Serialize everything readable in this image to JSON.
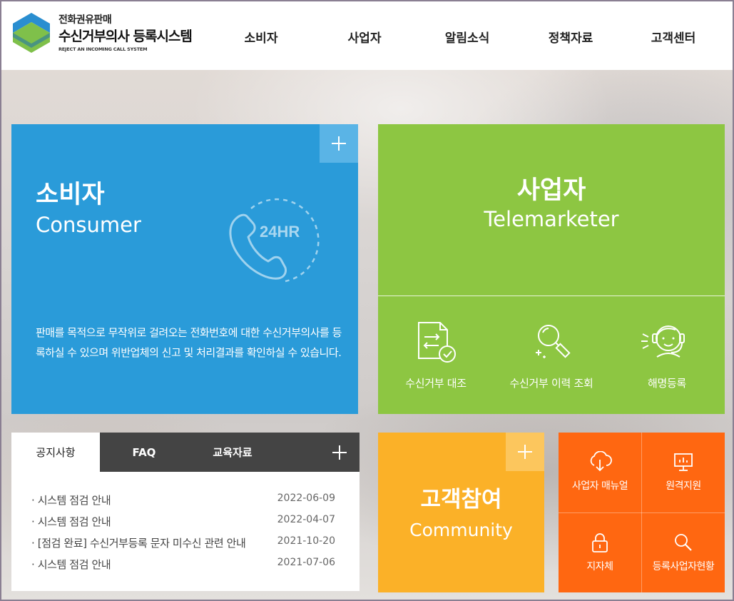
{
  "header": {
    "logo": {
      "subtitle": "전화권유판매",
      "title": "수신거부의사 등록시스템",
      "english": "REJECT AN INCOMING CALL SYSTEM"
    },
    "nav": [
      {
        "label": "소비자"
      },
      {
        "label": "사업자"
      },
      {
        "label": "알림소식"
      },
      {
        "label": "정책자료"
      },
      {
        "label": "고객센터"
      }
    ]
  },
  "consumer": {
    "title": "소비자",
    "title_en": "Consumer",
    "badge": "24HR",
    "description": "판매를 목적으로 무작위로 걸려오는 전화번호에 대한 수신거부의사를 등록하실 수 있으며 위반업체의 신고 및 처리결과를 확인하실 수 있습니다."
  },
  "telemarketer": {
    "title": "사업자",
    "title_en": "Telemarketer",
    "items": [
      {
        "label": "수신거부 대조"
      },
      {
        "label": "수신거부 이력 조회"
      },
      {
        "label": "해명등록"
      }
    ]
  },
  "notice": {
    "tabs": [
      {
        "label": "공지사항"
      },
      {
        "label": "FAQ"
      },
      {
        "label": "교육자료"
      }
    ],
    "rows": [
      {
        "title": "· 시스템 점검 안내",
        "date": "2022-06-09"
      },
      {
        "title": "· 시스템 점검 안내",
        "date": "2022-04-07"
      },
      {
        "title": "· [점검 완료] 수신거부등록 문자 미수신 관련 안내",
        "date": "2021-10-20"
      },
      {
        "title": "· 시스템 점검 안내",
        "date": "2021-07-06"
      }
    ]
  },
  "community": {
    "title": "고객참여",
    "title_en": "Community"
  },
  "quick_links": [
    {
      "label": "사업자 매뉴얼",
      "icon": "cloud-download-icon"
    },
    {
      "label": "원격지원",
      "icon": "monitor-icon"
    },
    {
      "label": "지자체",
      "icon": "lock-icon"
    },
    {
      "label": "등록사업자현황",
      "icon": "search-icon"
    }
  ],
  "colors": {
    "consumer": "#2a9bd9",
    "telemarketer": "#8dc642",
    "community": "#fbb128",
    "quick_links": "#ff6711",
    "tab_bar": "#444444"
  }
}
